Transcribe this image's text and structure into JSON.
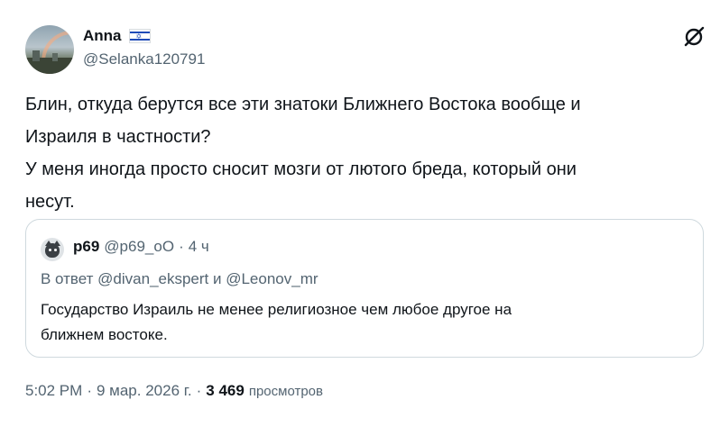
{
  "author": {
    "name": "Anna",
    "handle": "@Selanka120791",
    "flag_icon": "israel-flag",
    "flag_star": "✡"
  },
  "tweet": {
    "lines": [
      "Блин, откуда берутся все эти знатоки Ближнего Востока вообще и",
      "Израиля в частности?",
      "У меня иногда просто сносит мозги от лютого бреда, который они",
      "несут."
    ]
  },
  "quote": {
    "name": "p69",
    "handle": "@p69_oO",
    "separator": "·",
    "time": "4 ч",
    "reply_line": "В ответ @divan_ekspert и @Leonov_mr",
    "text_lines": [
      "Государство Израиль не менее религиозное чем любое другое на",
      "ближнем востоке."
    ]
  },
  "footer": {
    "time": "5:02 PM",
    "sep1": "·",
    "date": "9 мар. 2026 г.",
    "sep2": "·",
    "views": "3 469",
    "views_label": "просмотров"
  },
  "colors": {
    "text": "#0f1419",
    "secondary": "#536471",
    "border": "#cfd9de",
    "flag_blue": "#1f4bb8"
  },
  "icons": {
    "grok": "grok-icon"
  }
}
